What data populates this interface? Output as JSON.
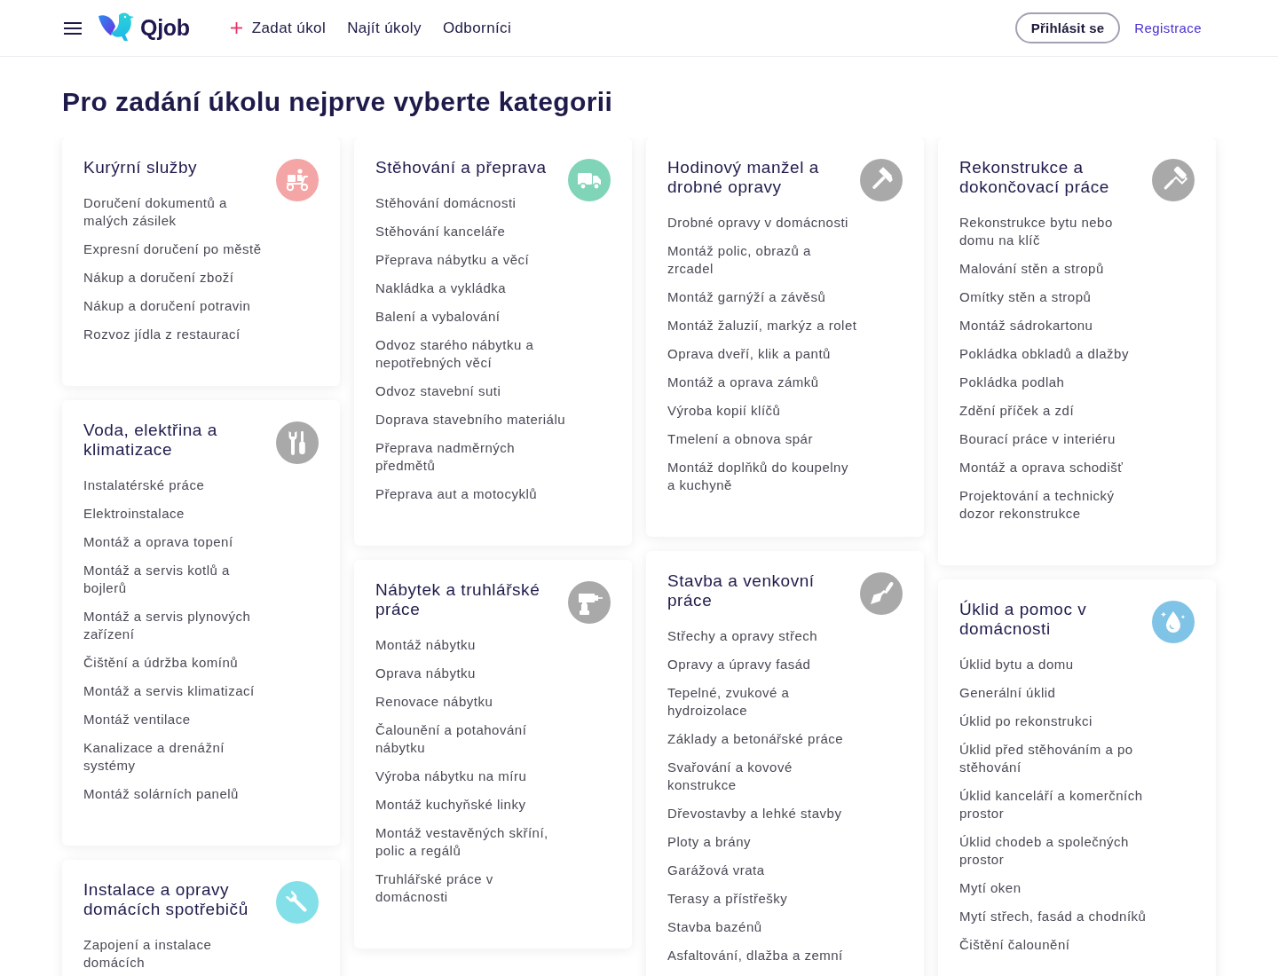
{
  "header": {
    "logo": "Qjob",
    "nav": [
      {
        "kind": "add",
        "label": "Zadat úkol"
      },
      {
        "kind": "plain",
        "label": "Najít úkoly"
      },
      {
        "kind": "plain",
        "label": "Odborníci"
      }
    ],
    "login_button": "Přihlásit se",
    "register_link": "Registrace"
  },
  "heading": "Pro zadání úkolu nejprve vyberte kategorii",
  "columns": [
    {
      "categories": [
        {
          "title": "Kurýrní služby",
          "color": "#f4a5a5",
          "items": [
            "Doručení dokumentů a malých zásilek",
            "Expresní doručení po městě",
            "Nákup a doručení zboží",
            "Nákup a doručení potravin",
            "Rozvoz jídla z restaurací"
          ]
        },
        {
          "title": "Voda, elektřina a klimatizace",
          "color": "#a9a9a9",
          "items": [
            "Instalatérské práce",
            "Elektroinstalace",
            "Montáž a oprava topení",
            "Montáž a servis kotlů a bojlerů",
            "Montáž a servis plynových zařízení",
            "Čištění a údržba komínů",
            "Montáž a servis klimatizací",
            "Montáž ventilace",
            "Kanalizace a drenážní systémy",
            "Montáž solárních panelů"
          ]
        },
        {
          "title": "Instalace a opravy domácích spotřebičů",
          "color": "#84e0e8",
          "items": [
            "Zapojení a instalace domácích"
          ]
        }
      ]
    },
    {
      "categories": [
        {
          "title": "Stěhování a přeprava",
          "color": "#80d4b8",
          "items": [
            "Stěhování domácnosti",
            "Stěhování kanceláře",
            "Přeprava nábytku a věcí",
            "Nakládka a vykládka",
            "Balení a vybalování",
            "Odvoz starého nábytku a nepotřebných věcí",
            "Odvoz stavební suti",
            "Doprava stavebního materiálu",
            "Přeprava nadměrných předmětů",
            "Přeprava aut a motocyklů"
          ]
        },
        {
          "title": "Nábytek a truhlářské práce",
          "color": "#a9a9a9",
          "items": [
            "Montáž nábytku",
            "Oprava nábytku",
            "Renovace nábytku",
            "Čalounění a potahování nábytku",
            "Výroba nábytku na míru",
            "Montáž kuchyňské linky",
            "Montáž vestavěných skříní, polic a regálů",
            "Truhlářské práce v domácnosti"
          ]
        }
      ]
    },
    {
      "categories": [
        {
          "title": "Hodinový manžel a drobné opravy",
          "color": "#a9a9a9",
          "items": [
            "Drobné opravy v domácnosti",
            "Montáž polic, obrazů a zrcadel",
            "Montáž garnýží a závěsů",
            "Montáž žaluzií, markýz a rolet",
            "Oprava dveří, klik a pantů",
            "Montáž a oprava zámků",
            "Výroba kopií klíčů",
            "Tmelení a obnova spár",
            "Montáž doplňků do koupelny a kuchyně"
          ]
        },
        {
          "title": "Stavba a venkovní práce",
          "color": "#a9a9a9",
          "items": [
            "Střechy a opravy střech",
            "Opravy a úpravy fasád",
            "Tepelné, zvukové a hydroizolace",
            "Základy a betonářské práce",
            "Svařování a kovové konstrukce",
            "Dřevostavby a lehké stavby",
            "Ploty a brány",
            "Garážová vrata",
            "Terasy a přístřešky",
            "Stavba bazénů",
            "Asfaltování, dlažba a zemní"
          ]
        }
      ]
    },
    {
      "categories": [
        {
          "title": "Rekonstrukce a dokončovací práce",
          "color": "#a9a9a9",
          "items": [
            "Rekonstrukce bytu nebo domu na klíč",
            "Malování stěn a stropů",
            "Omítky stěn a stropů",
            "Montáž sádrokartonu",
            "Pokládka obkladů a dlažby",
            "Pokládka podlah",
            "Zdění příček a zdí",
            "Bourací práce v interiéru",
            "Montáž a oprava schodišť",
            "Projektování a technický dozor rekonstrukce"
          ]
        },
        {
          "title": "Úklid a pomoc v domácnosti",
          "color": "#7fc3e6",
          "items": [
            "Úklid bytu a domu",
            "Generální úklid",
            "Úklid po rekonstrukci",
            "Úklid před stěhováním a po stěhování",
            "Úklid kanceláří a komerčních prostor",
            "Úklid chodeb a společných prostor",
            "Mytí oken",
            "Mytí střech, fasád a chodníků",
            "Čištění čalounění"
          ]
        }
      ]
    }
  ]
}
